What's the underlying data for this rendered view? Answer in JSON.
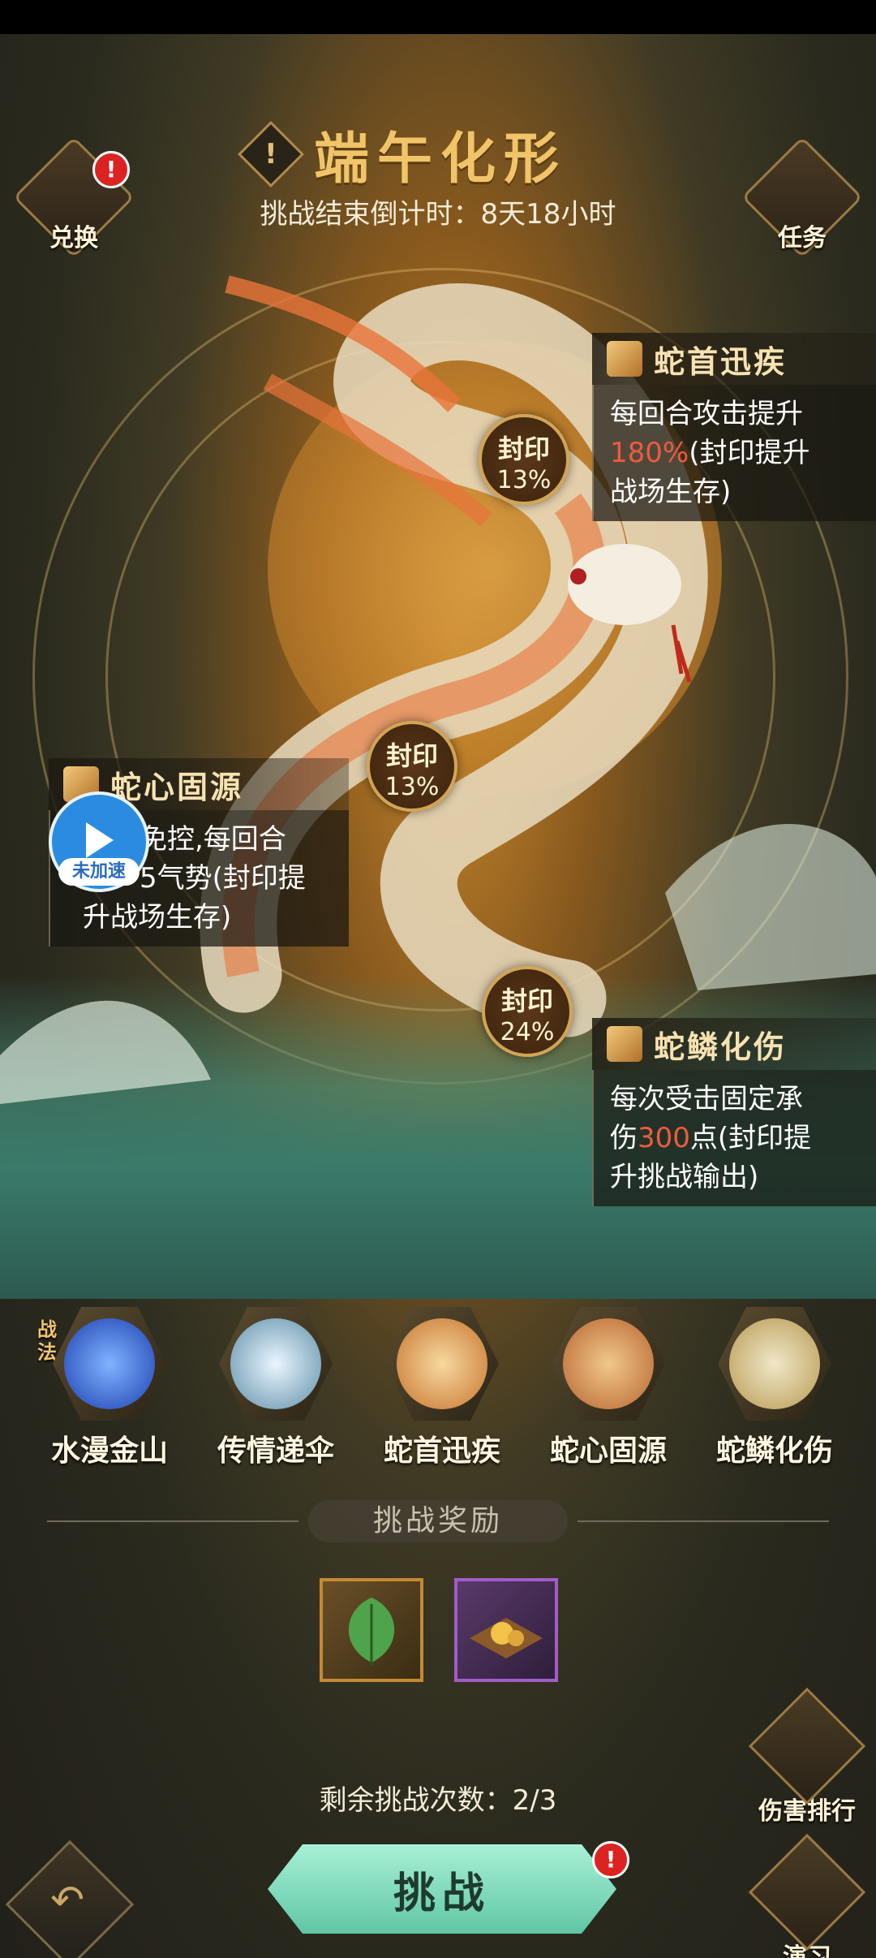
{
  "header": {
    "title": "端午化形",
    "alert_icon": "exclamation-icon",
    "countdown": "挑战结束倒计时：8天18小时"
  },
  "left_button": {
    "label": "兑换",
    "badge": "!",
    "icon": "leaf-icon"
  },
  "right_button": {
    "label": "任务",
    "icon": "scroll-icon"
  },
  "seals": [
    {
      "label": "封印",
      "percent": "13%"
    },
    {
      "label": "封印",
      "percent": "13%"
    },
    {
      "label": "封印",
      "percent": "24%"
    }
  ],
  "skills_callouts": {
    "head": {
      "name": "蛇首迅疾",
      "desc_1": "每回合攻击提升",
      "desc_hl": "180%",
      "desc_2": "(封印提升",
      "desc_3": "战场生存)"
    },
    "heart": {
      "name": "蛇心固源",
      "desc_1": "免控,每回合",
      "desc_2": "5气势(封印提",
      "desc_3": "升战场生存)"
    },
    "scale": {
      "name": "蛇鳞化伤",
      "desc_1": "每次受击固定承",
      "desc_2a": "伤",
      "desc_hl": "300",
      "desc_2b": "点(封印提",
      "desc_3": "升挑战输出)"
    }
  },
  "speed_widget": {
    "label": "未加速",
    "icon": "play-icon"
  },
  "skill_bar": {
    "tag": "战法",
    "items": [
      {
        "label": "水漫金山",
        "icon": "water-wave-icon"
      },
      {
        "label": "传情递伞",
        "icon": "heart-umbrella-icon"
      },
      {
        "label": "蛇首迅疾",
        "icon": "serpent-head-icon"
      },
      {
        "label": "蛇心固源",
        "icon": "serpent-heart-icon"
      },
      {
        "label": "蛇鳞化伤",
        "icon": "serpent-scale-icon"
      }
    ]
  },
  "rewards": {
    "title": "挑战奖励",
    "items": [
      {
        "icon": "green-leaf-icon",
        "rarity_color": "#c48a32"
      },
      {
        "icon": "gold-ore-tray-icon",
        "rarity_color": "#a25cc8"
      }
    ]
  },
  "remaining": "剩余挑战次数：2/3",
  "challenge_button": {
    "label": "挑战",
    "badge": "!"
  },
  "damage_rank_button": {
    "label": "伤害排行",
    "icon": "bar-chart-banner-icon"
  },
  "practice_button": {
    "label": "演习",
    "icon": "sword-icon"
  },
  "back_button": {
    "icon": "back-arrow-icon"
  }
}
